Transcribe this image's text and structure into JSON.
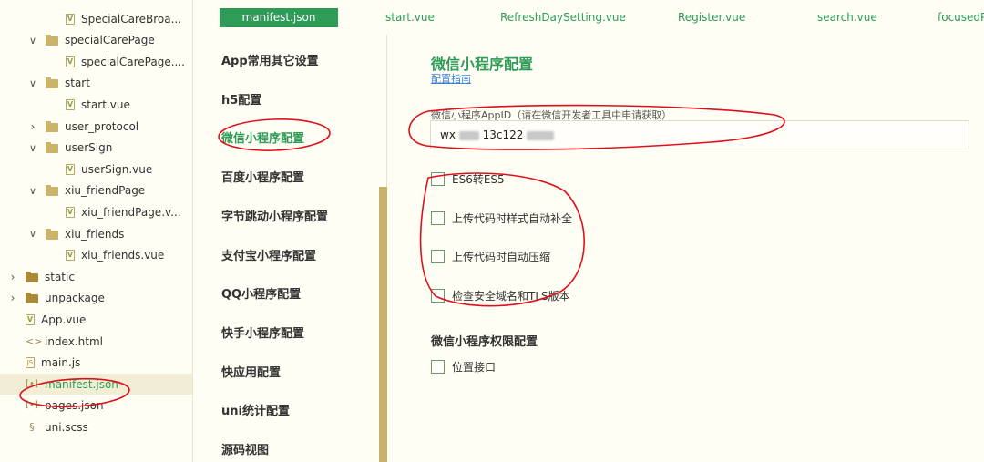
{
  "file_tree": [
    {
      "label": "SpecialCareBroa...",
      "type": "vue",
      "indent": 3,
      "arrow": ""
    },
    {
      "label": "specialCarePage",
      "type": "folder-open",
      "indent": 2,
      "arrow": "open"
    },
    {
      "label": "specialCarePage....",
      "type": "vue",
      "indent": 3,
      "arrow": ""
    },
    {
      "label": "start",
      "type": "folder-open",
      "indent": 2,
      "arrow": "open"
    },
    {
      "label": "start.vue",
      "type": "vue",
      "indent": 3,
      "arrow": ""
    },
    {
      "label": "user_protocol",
      "type": "folder-open",
      "indent": 2,
      "arrow": "closed"
    },
    {
      "label": "userSign",
      "type": "folder-open",
      "indent": 2,
      "arrow": "open"
    },
    {
      "label": "userSign.vue",
      "type": "vue",
      "indent": 3,
      "arrow": ""
    },
    {
      "label": "xiu_friendPage",
      "type": "folder-open",
      "indent": 2,
      "arrow": "open"
    },
    {
      "label": "xiu_friendPage.v...",
      "type": "vue",
      "indent": 3,
      "arrow": ""
    },
    {
      "label": "xiu_friends",
      "type": "folder-open",
      "indent": 2,
      "arrow": "open"
    },
    {
      "label": "xiu_friends.vue",
      "type": "vue",
      "indent": 3,
      "arrow": ""
    },
    {
      "label": "static",
      "type": "folder-closed",
      "indent": 1,
      "arrow": "closed"
    },
    {
      "label": "unpackage",
      "type": "folder-closed",
      "indent": 1,
      "arrow": "closed"
    },
    {
      "label": "App.vue",
      "type": "vue",
      "indent": 1,
      "arrow": ""
    },
    {
      "label": "index.html",
      "type": "html",
      "indent": 1,
      "arrow": ""
    },
    {
      "label": "main.js",
      "type": "js",
      "indent": 1,
      "arrow": ""
    },
    {
      "label": "manifest.json",
      "type": "json",
      "indent": 1,
      "arrow": "",
      "selected": true
    },
    {
      "label": "pages.json",
      "type": "json",
      "indent": 1,
      "arrow": ""
    },
    {
      "label": "uni.scss",
      "type": "scss",
      "indent": 1,
      "arrow": ""
    }
  ],
  "tabs": [
    {
      "label": "manifest.json",
      "active": true
    },
    {
      "label": "start.vue"
    },
    {
      "label": "RefreshDaySetting.vue"
    },
    {
      "label": "Register.vue"
    },
    {
      "label": "search.vue"
    },
    {
      "label": "focusedP"
    }
  ],
  "nav": [
    {
      "label": "App常用其它设置"
    },
    {
      "label": "h5配置"
    },
    {
      "label": "微信小程序配置",
      "active": true
    },
    {
      "label": "百度小程序配置"
    },
    {
      "label": "字节跳动小程序配置"
    },
    {
      "label": "支付宝小程序配置"
    },
    {
      "label": "QQ小程序配置"
    },
    {
      "label": "快手小程序配置"
    },
    {
      "label": "快应用配置"
    },
    {
      "label": "uni统计配置"
    },
    {
      "label": "源码视图"
    }
  ],
  "content": {
    "title": "微信小程序配置",
    "guide_link": "配置指南",
    "appid_label": "微信小程序AppID（请在微信开发者工具中申请获取）",
    "appid_value_prefix": "wx",
    "appid_value_visible": "13c122",
    "options": [
      {
        "label": "ES6转ES5",
        "checked": false
      },
      {
        "label": "上传代码时样式自动补全",
        "checked": false
      },
      {
        "label": "上传代码时自动压缩",
        "checked": false
      },
      {
        "label": "检查安全域名和TLS版本",
        "checked": false
      }
    ],
    "permissions_title": "微信小程序权限配置",
    "permissions": [
      {
        "label": "位置接口",
        "checked": false
      }
    ]
  },
  "colors": {
    "accent": "#2e9b57",
    "annotation": "#e0101a",
    "link": "#3c7fd6"
  }
}
